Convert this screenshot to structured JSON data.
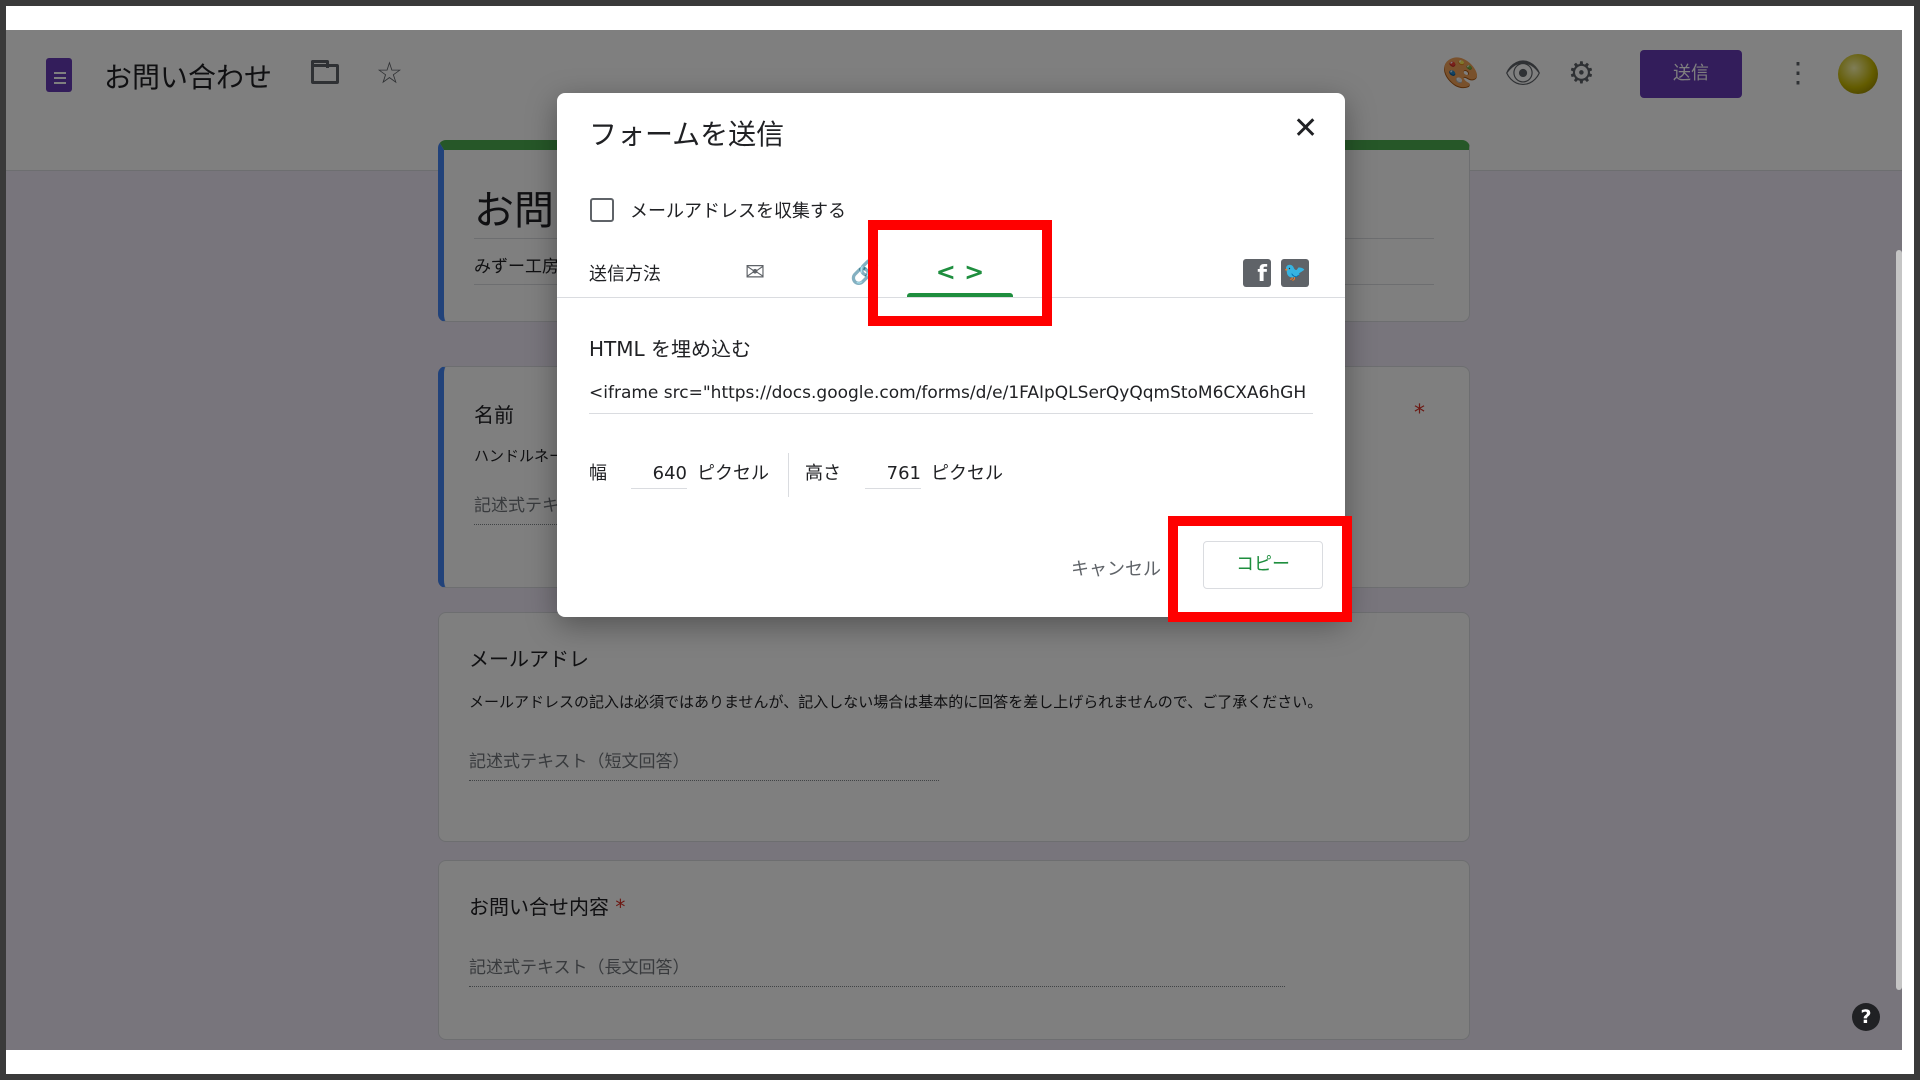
{
  "header": {
    "doc_title": "お問い合わせ",
    "send_label": "送信"
  },
  "form": {
    "title": "お問",
    "subtitle": "みずー工房",
    "questions": [
      {
        "title": "名前",
        "description": "ハンドルネー",
        "answer_placeholder": "記述式テキ"
      },
      {
        "title": "メールアドレ",
        "description": "メールアドレスの記入は必須ではありませんが、記入しない場合は基本的に回答を差し上げられませんので、ご了承ください。",
        "answer_placeholder": "記述式テキスト（短文回答）"
      },
      {
        "title": "お問い合せ内容",
        "required_mark": "*",
        "answer_placeholder": "記述式テキスト（長文回答）"
      }
    ],
    "required_mark": "*"
  },
  "dialog": {
    "title": "フォームを送信",
    "collect_email_label": "メールアドレスを収集する",
    "send_method_label": "送信方法",
    "tabs": [
      {
        "icon": "email-icon",
        "glyph": "✉"
      },
      {
        "icon": "link-icon",
        "glyph": "🔗"
      },
      {
        "icon": "embed-code-icon",
        "glyph": "< >"
      }
    ],
    "embed_heading": "HTML を埋め込む",
    "embed_code": "<iframe src=\"https://docs.google.com/forms/d/e/1FAIpQLSerQyQqmStoM6CXA6hGH",
    "width_label": "幅",
    "width_value": "640",
    "height_label": "高さ",
    "height_value": "761",
    "unit_label": "ピクセル",
    "cancel_label": "キャンセル",
    "copy_label": "コピー"
  },
  "colors": {
    "accent": "#673ab7",
    "green": "#1e8e3e",
    "highlight": "#ff0000"
  }
}
